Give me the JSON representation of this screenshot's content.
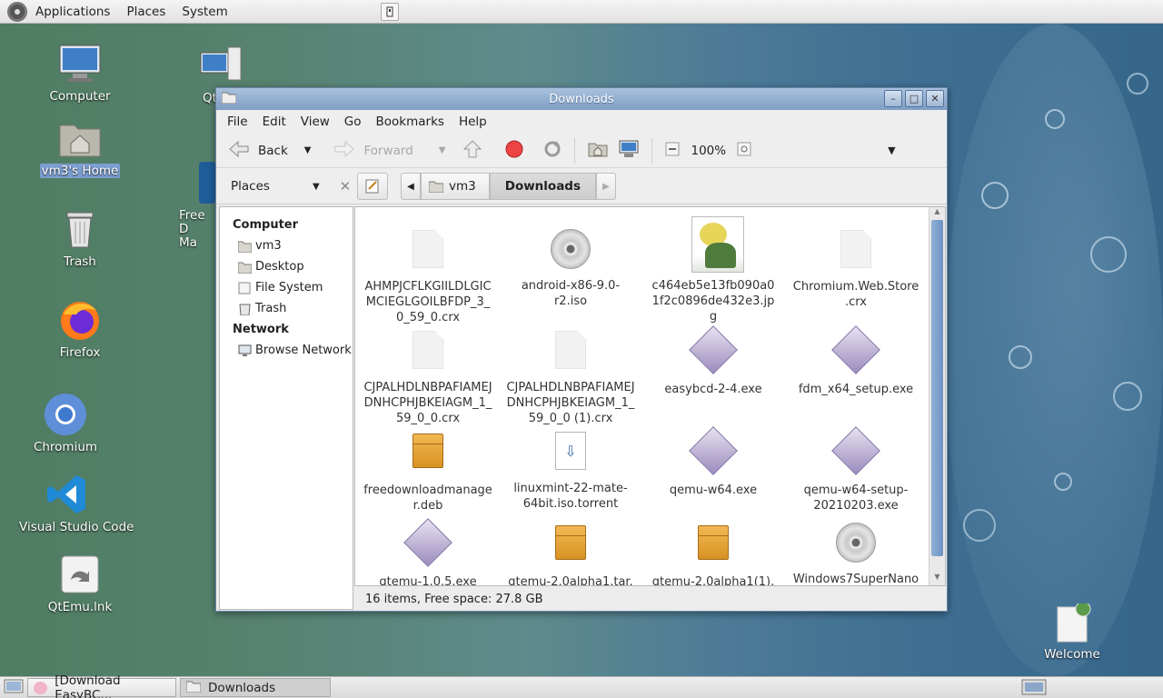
{
  "top_panel": {
    "menus": [
      "Applications",
      "Places",
      "System"
    ]
  },
  "desktop": {
    "icons": [
      {
        "label": "Computer"
      },
      {
        "label": "vm3's Home"
      },
      {
        "label": "Trash"
      },
      {
        "label": "Firefox"
      },
      {
        "label": "Chromium"
      },
      {
        "label": "Visual Studio Code"
      },
      {
        "label": "QtEmu.lnk"
      },
      {
        "label": "Welcome"
      },
      {
        "label": "Qt"
      },
      {
        "label": "Free D\nMa"
      }
    ]
  },
  "window": {
    "title": "Downloads",
    "menus": [
      "File",
      "Edit",
      "View",
      "Go",
      "Bookmarks",
      "Help"
    ],
    "toolbar": {
      "back": "Back",
      "forward": "Forward",
      "zoom": "100%"
    },
    "sidebar": {
      "header": "Places",
      "sections": [
        {
          "title": "Computer",
          "items": [
            "vm3",
            "Desktop",
            "File System",
            "Trash"
          ]
        },
        {
          "title": "Network",
          "items": [
            "Browse Network"
          ]
        }
      ]
    },
    "breadcrumb": [
      "vm3",
      "Downloads"
    ],
    "files": [
      {
        "name": "AHMPJCFLKGIILDLGICMCIEGLGOILBFDP_3_0_59_0.crx",
        "icon": "document"
      },
      {
        "name": "android-x86-9.0-r2.iso",
        "icon": "disc"
      },
      {
        "name": "c464eb5e13fb090a01f2c0896de432e3.jpg",
        "icon": "image"
      },
      {
        "name": "Chromium.Web.Store.crx",
        "icon": "document"
      },
      {
        "name": "CJPALHDLNBPAFIAMEJDNHCPHJBKEIAGM_1_59_0_0.crx",
        "icon": "document"
      },
      {
        "name": "CJPALHDLNBPAFIAMEJDNHCPHJBKEIAGM_1_59_0_0 (1).crx",
        "icon": "document"
      },
      {
        "name": "easybcd-2-4.exe",
        "icon": "executable"
      },
      {
        "name": "fdm_x64_setup.exe",
        "icon": "executable"
      },
      {
        "name": "freedownloadmanager.deb",
        "icon": "package"
      },
      {
        "name": "linuxmint-22-mate-64bit.iso.torrent",
        "icon": "torrent"
      },
      {
        "name": "qemu-w64.exe",
        "icon": "executable"
      },
      {
        "name": "qemu-w64-setup-20210203.exe",
        "icon": "executable"
      },
      {
        "name": "qtemu-1.0.5.exe",
        "icon": "executable"
      },
      {
        "name": "qtemu-2.0alpha1.tar.",
        "icon": "package"
      },
      {
        "name": "qtemu-2.0alpha1(1).",
        "icon": "package"
      },
      {
        "name": "Windows7SuperNano",
        "icon": "disc"
      }
    ],
    "status": "16 items, Free space: 27.8 GB"
  },
  "taskbar": {
    "tasks": [
      "[Download EasyBC...",
      "Downloads"
    ]
  }
}
